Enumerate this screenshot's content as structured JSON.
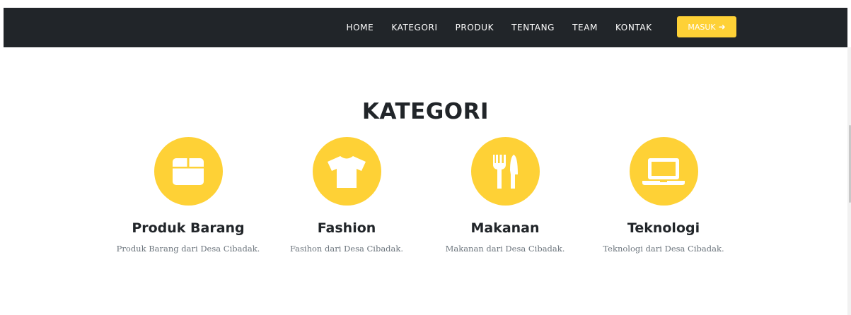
{
  "navbar": {
    "links": [
      "HOME",
      "KATEGORI",
      "PRODUK",
      "TENTANG",
      "TEAM",
      "KONTAK"
    ],
    "login_label": "MASUK",
    "login_icon": "sign-in-icon"
  },
  "section": {
    "title": "KATEGORI"
  },
  "categories": [
    {
      "title": "Produk Barang",
      "description": "Produk Barang dari Desa Cibadak.",
      "icon": "box-icon"
    },
    {
      "title": "Fashion",
      "description": "Fasihon dari Desa Cibadak.",
      "icon": "tshirt-icon"
    },
    {
      "title": "Makanan",
      "description": "Makanan dari Desa Cibadak.",
      "icon": "utensils-icon"
    },
    {
      "title": "Teknologi",
      "description": "Teknologi dari Desa Cibadak.",
      "icon": "laptop-icon"
    }
  ],
  "colors": {
    "navbar_bg": "#212529",
    "accent": "#fed136",
    "heading": "#212529",
    "muted": "#6c757d"
  }
}
